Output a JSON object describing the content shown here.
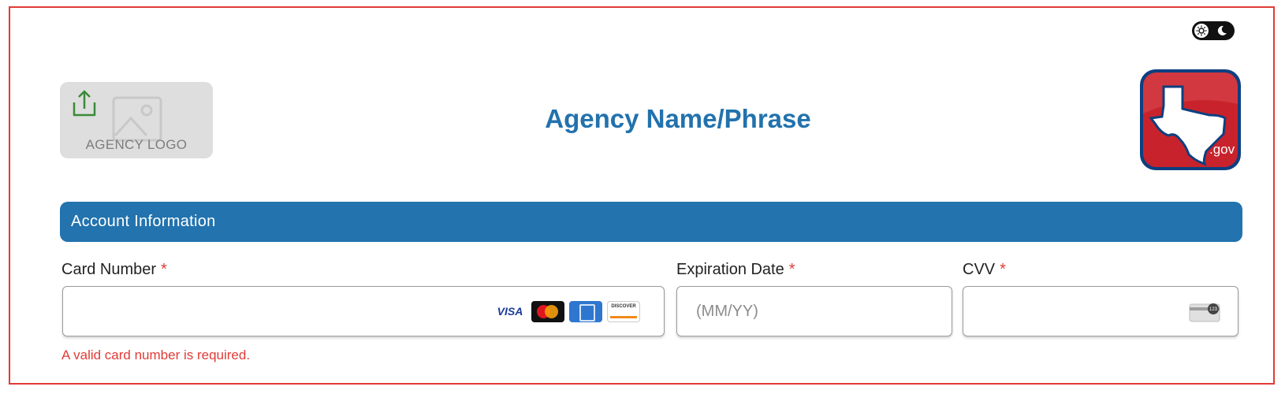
{
  "header": {
    "agency_logo_label": "AGENCY LOGO",
    "title": "Agency Name/Phrase",
    "gov_badge_text": ".gov"
  },
  "section": {
    "title": "Account Information"
  },
  "fields": {
    "card_number": {
      "label": "Card Number",
      "required_marker": "*",
      "value": "",
      "placeholder": "",
      "card_brands": [
        "VISA",
        "Mastercard",
        "American Express",
        "DISCOVER"
      ],
      "error": "A valid card number is required."
    },
    "expiration": {
      "label": "Expiration Date",
      "required_marker": "*",
      "value": "",
      "placeholder": "(MM/YY)"
    },
    "cvv": {
      "label": "CVV",
      "required_marker": "*",
      "value": "",
      "placeholder": "",
      "icon_text": "123"
    }
  },
  "icons": {
    "theme_toggle": [
      "sun-icon",
      "moon-icon"
    ],
    "upload": "upload-icon",
    "placeholder_image": "image-placeholder-icon",
    "cvv": "card-cvv-icon"
  },
  "colors": {
    "accent_blue": "#2273ae",
    "error_red": "#e03b36",
    "frame_border": "#e03b36",
    "upload_green": "#3a8a3a",
    "badge_red": "#c8232c"
  }
}
